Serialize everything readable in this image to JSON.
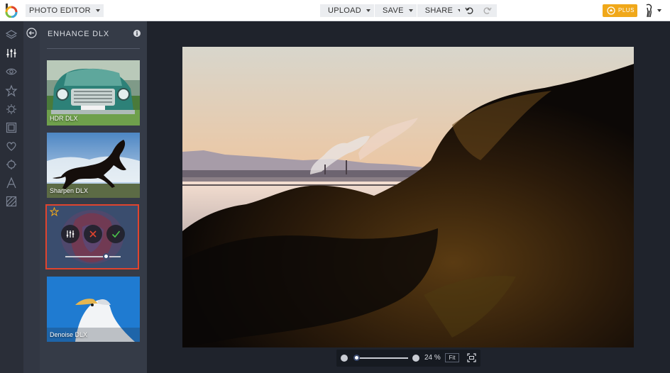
{
  "topbar": {
    "mode": "PHOTO EDITOR",
    "menu": [
      {
        "label": "UPLOAD",
        "icon": "chevron-down-icon"
      },
      {
        "label": "SAVE",
        "icon": "chevron-down-icon"
      },
      {
        "label": "SHARE",
        "icon": "chevron-down-icon"
      }
    ],
    "undo_icon": "undo-icon",
    "redo_icon": "redo-icon",
    "plus_label": "PLUS",
    "accent": "#f0a81a"
  },
  "rail": {
    "items": [
      "layers-icon",
      "adjust-icon",
      "eye-icon",
      "star-icon",
      "gear-icon",
      "frame-icon",
      "heart-icon",
      "texture-icon",
      "text-icon",
      "pattern-icon"
    ],
    "active": "adjust-icon"
  },
  "panel": {
    "title": "ENHANCE DLX",
    "info": "i",
    "cards": [
      {
        "label": "HDR DLX"
      },
      {
        "label": "Sharpen DLX"
      },
      {
        "label": ""
      },
      {
        "label": "Denoise DLX"
      }
    ],
    "active_highlight": "#e0442e",
    "active_slider_fraction": 0.74
  },
  "zoom": {
    "value": "24 %",
    "fit": "Fit",
    "fraction": 0.05
  }
}
